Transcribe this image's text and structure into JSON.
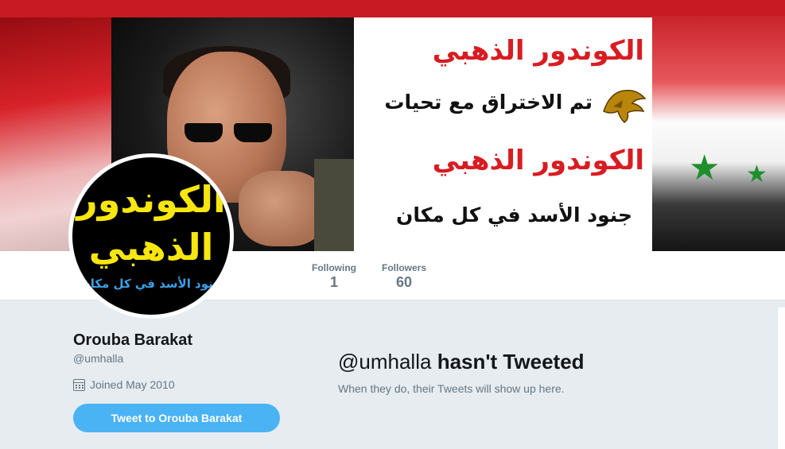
{
  "banner": {
    "title_line_1": "الكوندور الذهبي",
    "line_2": "تم الاختراق مع تحيات",
    "title_line_3": "الكوندور الذهبي",
    "line_4": "جنود الأسد في كل مكان"
  },
  "avatar": {
    "line_1": "الكوندور",
    "line_2": "الذهبي",
    "line_3": "جنود الأسد في كل مكان"
  },
  "stats": [
    {
      "label": "Following",
      "value": "1"
    },
    {
      "label": "Followers",
      "value": "60"
    }
  ],
  "profile": {
    "name": "Orouba Barakat",
    "handle": "@umhalla",
    "joined": "Joined May 2010",
    "tweet_button": "Tweet to Orouba Barakat"
  },
  "timeline": {
    "empty_handle": "@umhalla",
    "empty_title": "hasn't Tweeted",
    "empty_sub": "When they do, their Tweets will show up here."
  },
  "colors": {
    "accent": "#4ab3f4",
    "banner_red": "#d81d22",
    "avatar_yellow": "#f7e60f",
    "avatar_blue": "#3aa0e6"
  },
  "icons": [
    "calendar-icon",
    "eagle-emblem-icon",
    "flag-star-icon"
  ]
}
